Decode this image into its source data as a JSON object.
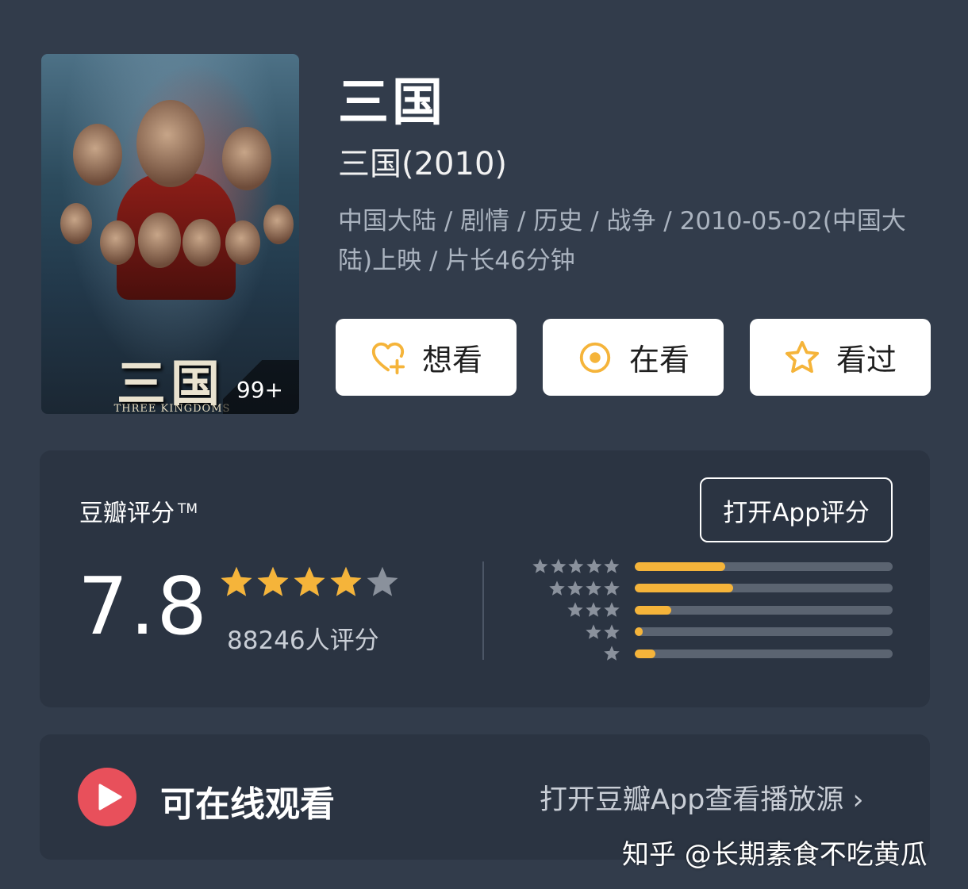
{
  "poster": {
    "title_art": "三国",
    "subtitle_art": "THREE KINGDOMS",
    "badge": "99+"
  },
  "title": "三国",
  "subtitle": "三国(2010)",
  "meta": "中国大陆 / 剧情 / 历史 / 战争 / 2010-05-02(中国大陆)上映 / 片长46分钟",
  "actions": [
    {
      "label": "想看",
      "icon": "heart-plus-icon"
    },
    {
      "label": "在看",
      "icon": "target-circle-icon"
    },
    {
      "label": "看过",
      "icon": "star-outline-icon"
    }
  ],
  "rating": {
    "label": "豆瓣评分",
    "tm": "TM",
    "open_app_label": "打开App评分",
    "score": "7.8",
    "stars": 3.9,
    "count_text": "88246人评分",
    "distribution": [
      {
        "stars": 5,
        "fraction": 0.35
      },
      {
        "stars": 4,
        "fraction": 0.38
      },
      {
        "stars": 3,
        "fraction": 0.14
      },
      {
        "stars": 2,
        "fraction": 0.03
      },
      {
        "stars": 1,
        "fraction": 0.08
      }
    ]
  },
  "watch": {
    "label": "可在线观看",
    "link": "打开豆瓣App查看播放源 ›"
  },
  "watermark": "知乎 @长期素食不吃黄瓜",
  "colors": {
    "background": "#323c4b",
    "card": "#2b3442",
    "star": "#f5b43a",
    "star_empty": "#8a919c",
    "play": "#e8505b"
  }
}
